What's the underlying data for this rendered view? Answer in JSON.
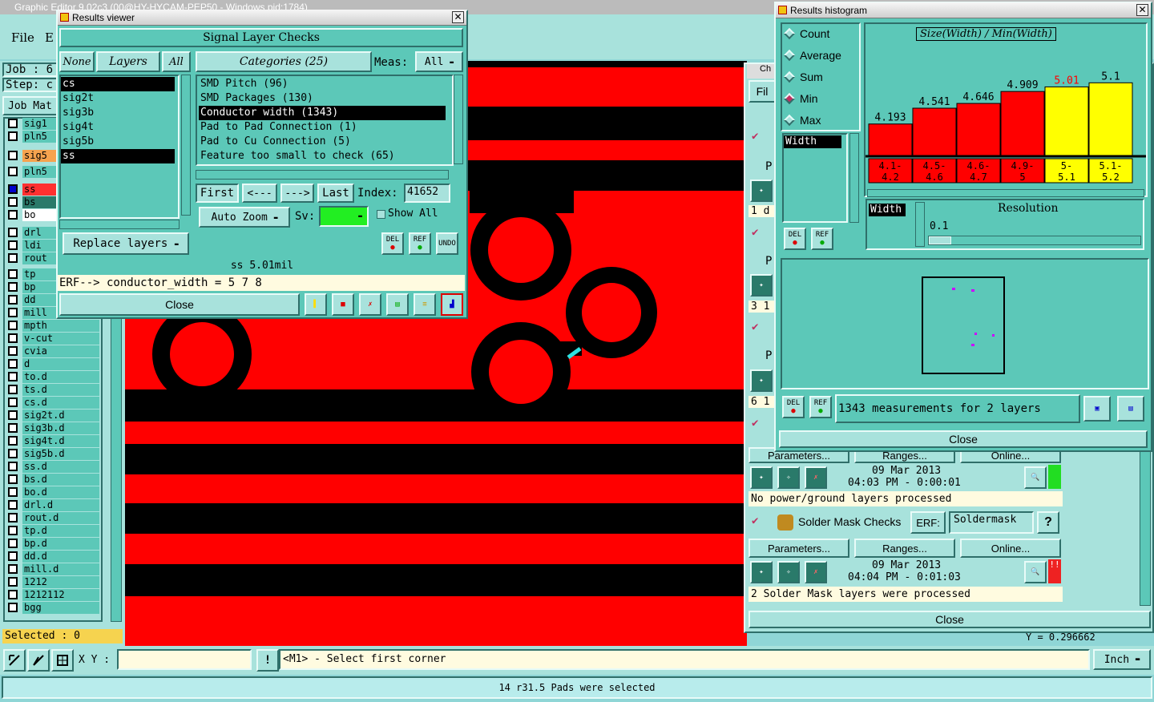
{
  "main_window": {
    "title": "Graphic Editor 9.02c3 (00@HY-HYCAM-PEP50 - Windows pid:1784)",
    "menu": [
      "File",
      "E"
    ],
    "job_label": "Job :",
    "job_value": "6",
    "step_label": "Step:",
    "step_value": "c",
    "job_matrix": "Job Mat",
    "selected": "Selected : 0",
    "xy_label": "X Y :",
    "xy_value": "",
    "prompt": "<M1> - Select first corner",
    "unit": "Inch",
    "status": "14 r31.5 Pads were selected",
    "coord_y": "Y = 0.296662"
  },
  "layers": [
    "sig1",
    "pln5",
    "sig5",
    "pln5",
    "ss",
    "bs",
    "bo",
    "drl",
    "ldi",
    "rout",
    "tp",
    "bp",
    "dd",
    "mill",
    "mpth",
    "v-cut",
    "cvia",
    "d",
    "to.d",
    "ts.d",
    "cs.d",
    "sig2t.d",
    "sig3b.d",
    "sig4t.d",
    "sig5b.d",
    "ss.d",
    "bs.d",
    "bo.d",
    "drl.d",
    "rout.d",
    "tp.d",
    "bp.d",
    "dd.d",
    "mill.d",
    "1212",
    "1212112",
    "bgg"
  ],
  "results_viewer": {
    "title": "Results viewer",
    "heading": "Signal Layer Checks",
    "none_btn": "None",
    "layers_btn": "Layers",
    "all_btn": "All",
    "categories_btn": "Categories (25)",
    "meas_label": "Meas:",
    "meas_value": "All",
    "layer_list": [
      "cs",
      "sig2t",
      "sig3b",
      "sig4t",
      "sig5b",
      "ss"
    ],
    "categories": [
      "SMD Pitch (96)",
      "SMD Packages (130)",
      "Conductor width (1343)",
      "Pad to Pad Connection (1)",
      "Pad to Cu Connection (5)",
      "Feature too small to check (65)"
    ],
    "first": "First",
    "prev": "<---",
    "next": "--->",
    "last": "Last",
    "index_label": "Index:",
    "index_value": "41652",
    "autozoom": "Auto Zoom",
    "sv_label": "Sv:",
    "show_all": "Show All",
    "replace_layers": "Replace layers",
    "del": "DEL",
    "ref": "REF",
    "undo": "UNDO",
    "measure": "ss 5.01mil",
    "erf_line": "ERF--> conductor_width = 5 7 8",
    "close": "Close"
  },
  "histogram": {
    "title": "Results histogram",
    "options": [
      "Count",
      "Average",
      "Sum",
      "Min",
      "Max"
    ],
    "selected_option": "Min",
    "chart_title": "Size(Width) / Min(Width)",
    "list_item": "Width",
    "resolution_label": "Resolution",
    "resolution_value": "0.1",
    "summary": "1343 measurements for 2 layers",
    "close": "Close",
    "del": "DEL",
    "ref": "REF"
  },
  "chart_data": {
    "type": "bar",
    "title": "Size(Width) / Min(Width)",
    "categories": [
      "4.1-4.2",
      "4.5-4.6",
      "4.6-4.7",
      "4.9-5",
      "5-5.1",
      "5.1-5.2"
    ],
    "values": [
      4.193,
      4.541,
      4.646,
      4.909,
      5.01,
      5.1
    ],
    "colors": [
      "#ff0000",
      "#ff0000",
      "#ff0000",
      "#ff0000",
      "#ffff00",
      "#ffff00"
    ]
  },
  "checklist": {
    "rows_a": [
      "P",
      "1 d",
      "P",
      "3 1",
      "P",
      "6 1"
    ],
    "params": "Parameters...",
    "ranges": "Ranges...",
    "online": "Online...",
    "date1": "09 Mar 2013",
    "time1": "04:03 PM - 0:00:01",
    "msg1": "No power/ground layers processed",
    "solder_title": "Solder Mask Checks",
    "erf_label": "ERF:",
    "erf_value": "Soldermask",
    "help": "?",
    "date2": "09 Mar 2013",
    "time2": "04:04 PM - 0:01:03",
    "msg2": "2 Solder Mask layers were processed",
    "close": "Close",
    "file": "Fil",
    "tab": "Ch"
  }
}
